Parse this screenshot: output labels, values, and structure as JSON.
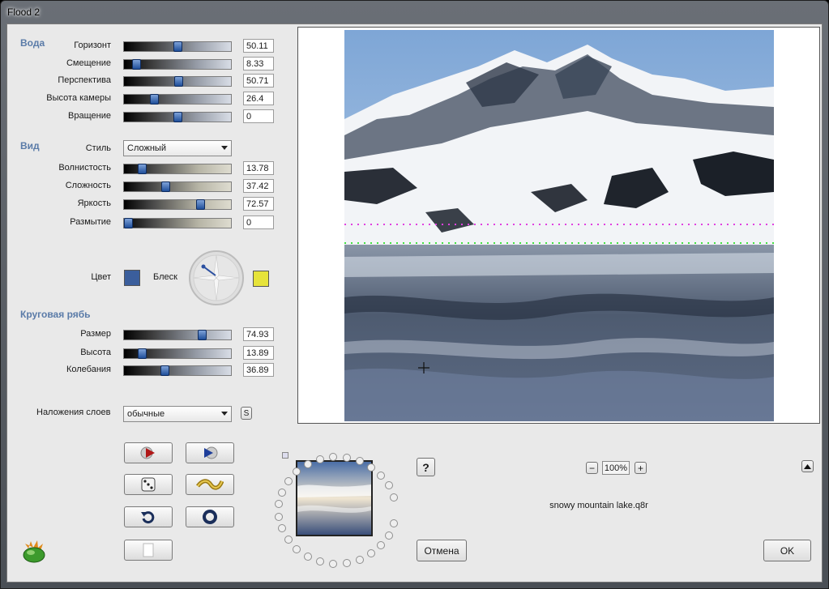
{
  "window": {
    "title": "Flood 2"
  },
  "water": {
    "section": "Вода",
    "rows": [
      {
        "label": "Горизонт",
        "value": "50.11",
        "level": 0.5011
      },
      {
        "label": "Смещение",
        "value": "8.33",
        "level": 0.0833
      },
      {
        "label": "Перспектива",
        "value": "50.71",
        "level": 0.5071
      },
      {
        "label": "Высота камеры",
        "value": "26.4",
        "level": 0.264
      },
      {
        "label": "Вращение",
        "value": "0",
        "level": 0.5
      }
    ]
  },
  "view": {
    "section": "Вид",
    "style_label": "Стиль",
    "style_value": "Сложный",
    "rows": [
      {
        "label": "Волнистость",
        "value": "13.78",
        "level": 0.1378
      },
      {
        "label": "Сложность",
        "value": "37.42",
        "level": 0.3742
      },
      {
        "label": "Яркость",
        "value": "72.57",
        "level": 0.7257
      },
      {
        "label": "Размытие",
        "value": "0",
        "level": 0
      }
    ],
    "color_label": "Цвет",
    "gloss_label": "Блеск",
    "color_swatch": "#3b5e9c",
    "gloss_swatch": "#e6e33a"
  },
  "ripple": {
    "section": "Круговая рябь",
    "rows": [
      {
        "label": "Размер",
        "value": "74.93",
        "level": 0.7493
      },
      {
        "label": "Высота",
        "value": "13.89",
        "level": 0.1389
      },
      {
        "label": "Колебания",
        "value": "36.89",
        "level": 0.3689
      }
    ]
  },
  "blend": {
    "label": "Наложения слоев",
    "value": "обычные",
    "s_label": "S"
  },
  "zoom": {
    "minus": "−",
    "value": "100%",
    "plus": "+"
  },
  "help_label": "?",
  "filename": "snowy mountain lake.q8r",
  "cancel_label": "Отмена",
  "ok_label": "OK",
  "colors": {
    "accent": "#5a7ba8",
    "guide_magenta": "#e040e0",
    "guide_green": "#40e040"
  }
}
